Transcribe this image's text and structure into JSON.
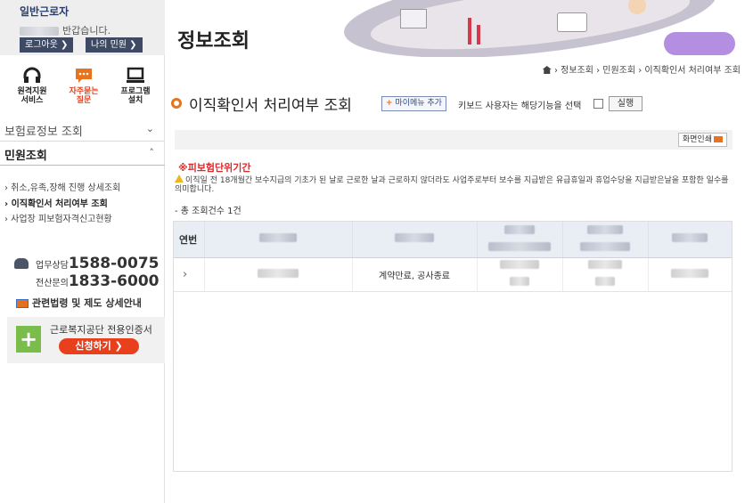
{
  "user": {
    "name": "일반근로자",
    "greeting": "반갑습니다.",
    "logout_label": "로그아웃",
    "mycase_label": "나의 민원"
  },
  "quick_links": [
    {
      "label1": "원격지원",
      "label2": "서비스",
      "icon": "headset-icon",
      "color": "#222222"
    },
    {
      "label1": "자주묻는",
      "label2": "질문",
      "icon": "chat-bubble-icon",
      "color": "#e8401c"
    },
    {
      "label1": "프로그램",
      "label2": "설치",
      "icon": "monitor-icon",
      "color": "#222222"
    }
  ],
  "menu": {
    "insurance_info": "보험료정보 조회",
    "civil": "민원조회",
    "sub_items": [
      "› 취소,유족,장해 진행 상세조회",
      "› 이직확인서 처리여부 조회",
      "› 사업장 피보험자격신고현황"
    ],
    "active_index": 1
  },
  "contact": {
    "line1_prefix": "업무상담",
    "line1_number": "1588-0075",
    "line2_prefix": "전산문의",
    "line2_number": "1833-6000",
    "law_link": "관련법령 및 제도 상세안내",
    "cert_title": "근로복지공단 전용인증서",
    "cert_button": "신청하기 ❯"
  },
  "header": {
    "title": "정보조회"
  },
  "breadcrumb": "› 정보조회 › 민원조회 › 이직확인서 처리여부 조회",
  "page": {
    "title": "이직확인서 처리여부 조회",
    "mymenu_label": "마이메뉴 추가",
    "keyboard_text": "키보드 사용자는 해당기능을 선택",
    "run_label": "실행",
    "print_label": "화면인쇄"
  },
  "notice": {
    "title": "※피보험단위기간",
    "body": "이직일 전 18개월간 보수지급의 기초가 된 날로 근로한 날과 근로하지 않더라도 사업주로부터 보수를 지급받은 유급휴일과 휴업수당을 지급받은날을 포함한 일수를 의미합니다."
  },
  "results": {
    "count_text": "- 총 조회건수 1건",
    "header_col1": "연번",
    "row_expand": "›",
    "row_status": "계약만료, 공사종료"
  },
  "colors": {
    "accent_orange": "#e8731c",
    "alert_red": "#d72a2a",
    "navy": "#3e4a63"
  }
}
